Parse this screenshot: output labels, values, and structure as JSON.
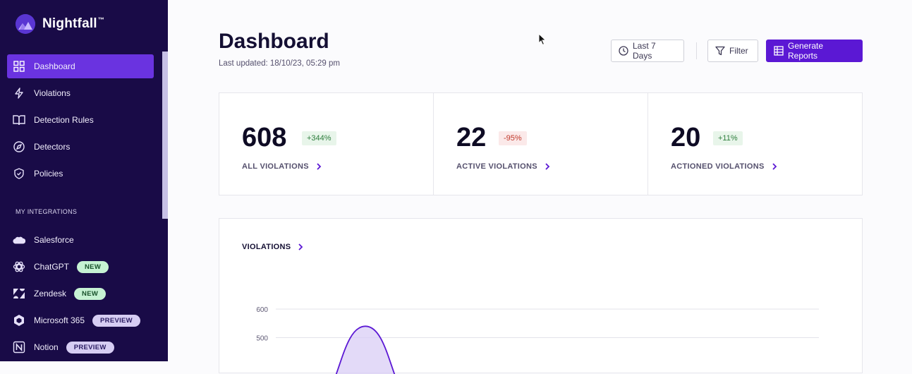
{
  "brand": {
    "name": "Nightfall",
    "tm": "™"
  },
  "nav": [
    {
      "label": "Dashboard",
      "icon": "dashboard-grid-icon",
      "active": true
    },
    {
      "label": "Violations",
      "icon": "lightning-icon"
    },
    {
      "label": "Detection Rules",
      "icon": "book-icon"
    },
    {
      "label": "Detectors",
      "icon": "compass-icon"
    },
    {
      "label": "Policies",
      "icon": "shield-icon"
    }
  ],
  "integrations_title": "MY INTEGRATIONS",
  "integrations": [
    {
      "label": "Salesforce",
      "icon": "salesforce-cloud-icon",
      "badge": ""
    },
    {
      "label": "ChatGPT",
      "icon": "chatgpt-icon",
      "badge": "NEW"
    },
    {
      "label": "Zendesk",
      "icon": "zendesk-icon",
      "badge": "NEW"
    },
    {
      "label": "Microsoft 365",
      "icon": "microsoft-365-icon",
      "badge": "PREVIEW"
    },
    {
      "label": "Notion",
      "icon": "notion-icon",
      "badge": "PREVIEW"
    }
  ],
  "header": {
    "title": "Dashboard",
    "last_updated": "Last updated: 18/10/23, 05:29 pm",
    "range_label": "Last 7 Days",
    "filter_label": "Filter",
    "generate_label": "Generate Reports"
  },
  "stats": [
    {
      "value": "608",
      "delta": "+344%",
      "trend": "up",
      "label": "ALL VIOLATIONS"
    },
    {
      "value": "22",
      "delta": "-95%",
      "trend": "down",
      "label": "ACTIVE VIOLATIONS"
    },
    {
      "value": "20",
      "delta": "+11%",
      "trend": "up",
      "label": "ACTIONED VIOLATIONS"
    }
  ],
  "colors": {
    "sidebar": "#190b47",
    "accent": "#5b18d4",
    "active_nav": "#6a33e0"
  },
  "chart_data": {
    "type": "area",
    "title": "VIOLATIONS",
    "y_ticks": [
      "600",
      "500"
    ],
    "ylim": [
      0,
      600
    ],
    "series": [
      {
        "values": [
          540
        ]
      }
    ]
  }
}
